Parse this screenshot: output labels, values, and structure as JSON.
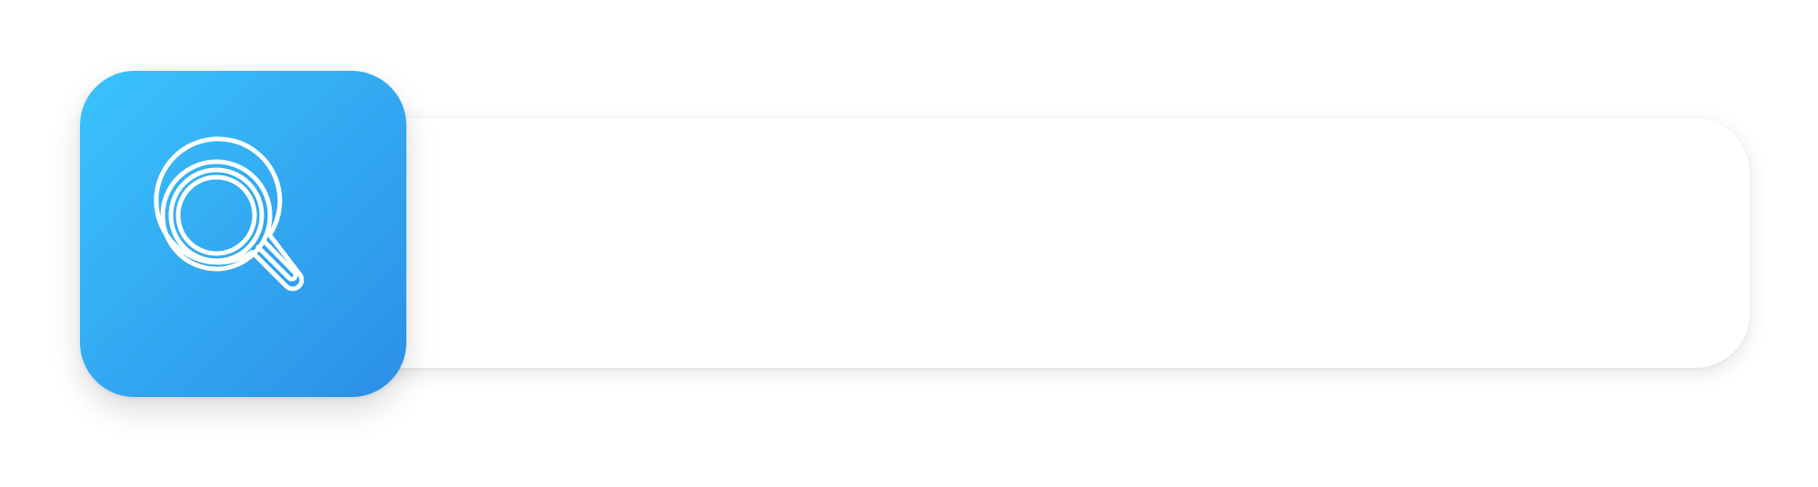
{
  "search": {
    "placeholder": "",
    "value": ""
  },
  "icons": {
    "search_button_icon": "magnifying-glass"
  },
  "colors": {
    "accent_start": "#3ac3fd",
    "accent_end": "#2b8fe6",
    "bar_background": "#ffffff"
  }
}
